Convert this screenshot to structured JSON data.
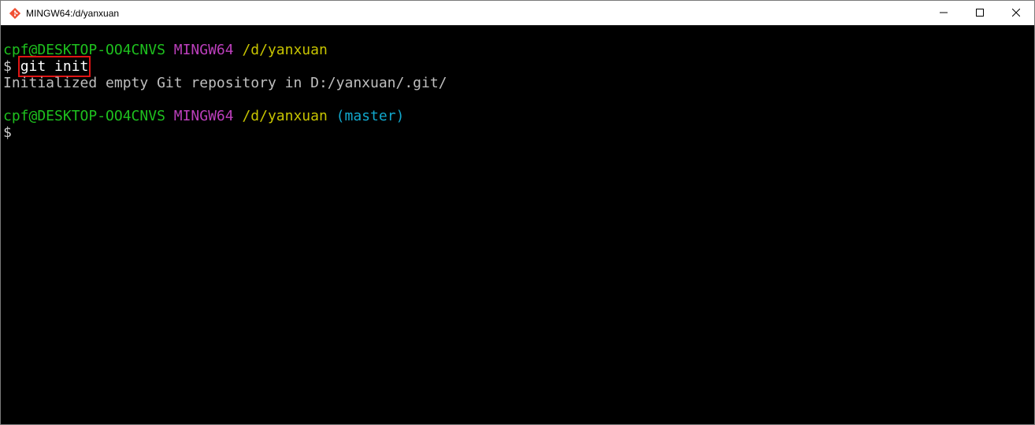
{
  "window": {
    "title": "MINGW64:/d/yanxuan",
    "icon": "git-icon",
    "controls": {
      "minimize": "minimize-icon",
      "maximize": "maximize-icon",
      "close": "close-icon"
    }
  },
  "terminal": {
    "prompt1": {
      "user_host": "cpf@DESKTOP-OO4CNVS",
      "env": "MINGW64",
      "path": "/d/yanxuan"
    },
    "line2": {
      "symbol": "$",
      "command": "git init"
    },
    "output": "Initialized empty Git repository in D:/yanxuan/.git/",
    "prompt2": {
      "user_host": "cpf@DESKTOP-OO4CNVS",
      "env": "MINGW64",
      "path": "/d/yanxuan",
      "branch": "(master)"
    },
    "line5": {
      "symbol": "$"
    }
  },
  "colors": {
    "user_host": "#1ec11e",
    "env": "#bc3fbc",
    "path": "#c7c400",
    "branch": "#11a8cd",
    "highlight_box": "#e01414"
  }
}
